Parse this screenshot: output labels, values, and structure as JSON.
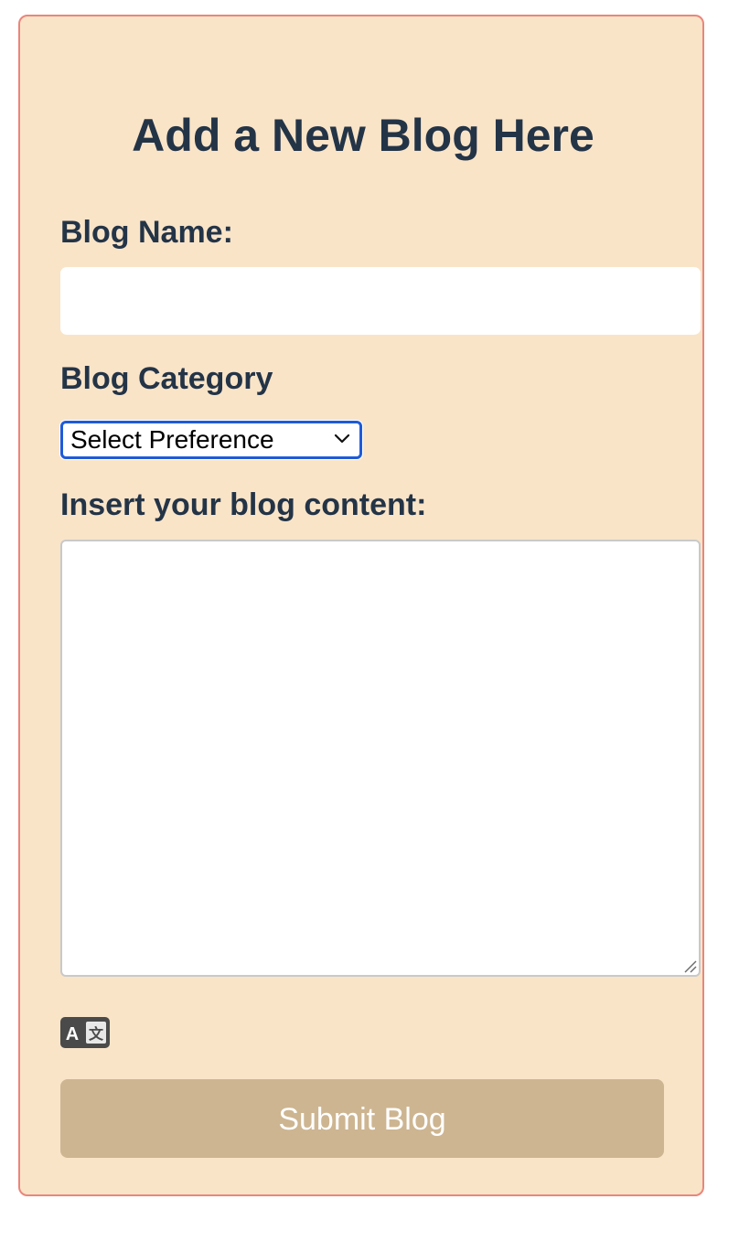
{
  "form": {
    "title": "Add a New Blog Here",
    "blog_name_label": "Blog Name:",
    "blog_name_value": "",
    "category_label": "Blog Category",
    "category_selected": "Select Preference",
    "content_label": "Insert your blog content:",
    "content_value": "",
    "submit_label": "Submit Blog"
  },
  "colors": {
    "card_background": "#f9e4c8",
    "card_border": "#e9867c",
    "text": "#243447",
    "select_focus_border": "#1f5bd8",
    "submit_background": "#cdb591",
    "submit_text": "#ffffff"
  },
  "icons": {
    "select_chevron": "chevron-down-icon",
    "textarea_resize": "resize-handle-icon",
    "translate": "translate-icon"
  }
}
